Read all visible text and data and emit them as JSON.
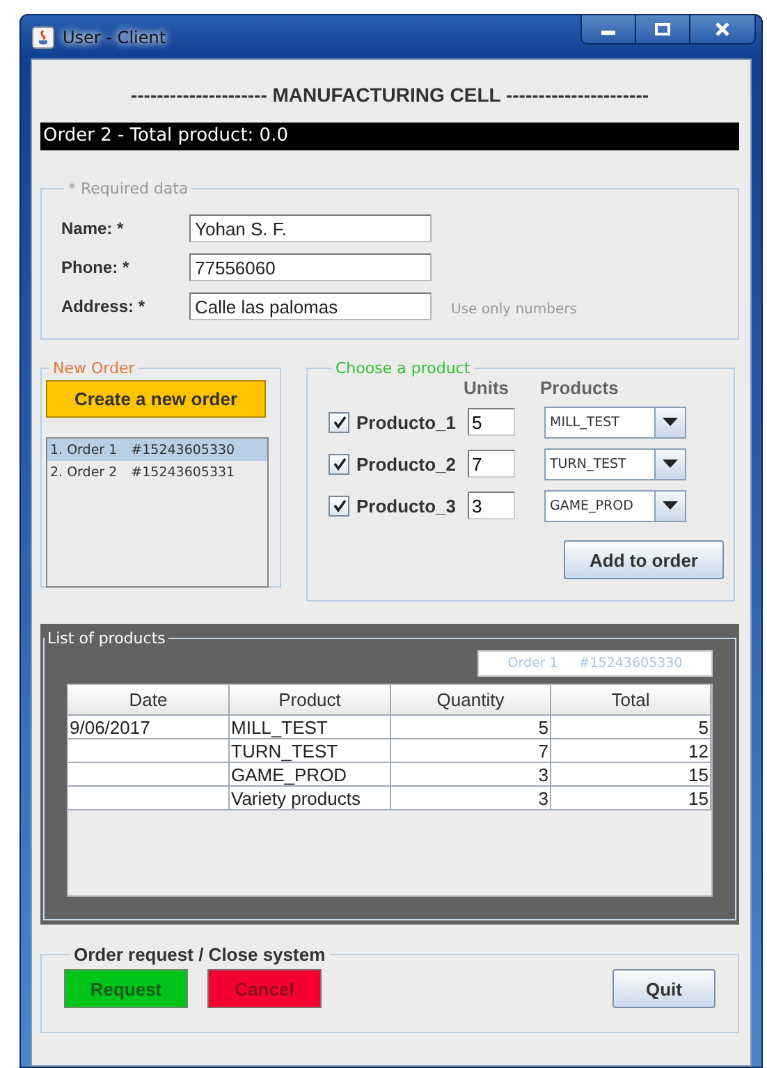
{
  "window": {
    "title": "User - Client"
  },
  "heading": "--------------------- MANUFACTURING CELL ----------------------",
  "status_bar": "Order 2 - Total product: 0.0",
  "required_data": {
    "legend": "* Required data",
    "fields": [
      {
        "label": "Name: *",
        "value": "Yohan S. F."
      },
      {
        "label": "Phone: *",
        "value": "77556060"
      },
      {
        "label": "Address: *",
        "value": "Calle las palomas",
        "hint": "Use only numbers"
      }
    ]
  },
  "new_order": {
    "legend": "New Order",
    "button": "Create a new order",
    "orders": [
      {
        "label": "1. Order 1",
        "id": "#15243605330",
        "selected": true
      },
      {
        "label": "2. Order 2",
        "id": "#15243605331",
        "selected": false
      }
    ]
  },
  "choose_product": {
    "legend": "Choose a product",
    "units_header": "Units",
    "products_header": "Products",
    "items": [
      {
        "name": "Producto_1",
        "checked": true,
        "units": "5",
        "product": "MILL_TEST"
      },
      {
        "name": "Producto_2",
        "checked": true,
        "units": "7",
        "product": "TURN_TEST"
      },
      {
        "name": "Producto_3",
        "checked": true,
        "units": "3",
        "product": "GAME_PROD"
      }
    ],
    "button": "Add to order"
  },
  "product_list": {
    "legend": "List of products",
    "order_label": "Order 1",
    "order_id": "#15243605330",
    "columns": [
      "Date",
      "Product",
      "Quantity",
      "Total"
    ],
    "rows": [
      {
        "date": "9/06/2017",
        "product": "MILL_TEST",
        "quantity": "5",
        "total": "5"
      },
      {
        "product": "TURN_TEST",
        "quantity": "7",
        "total": "12"
      },
      {
        "product": "GAME_PROD",
        "quantity": "3",
        "total": "15"
      },
      {
        "product": "Variety products",
        "quantity": "3",
        "total": "15"
      }
    ]
  },
  "order_request": {
    "legend": "Order request / Close system",
    "buttons": [
      {
        "label": "Request",
        "kind": "request"
      },
      {
        "label": "Cancel",
        "kind": "cancel"
      },
      {
        "label": "Quit",
        "kind": "quit"
      }
    ]
  }
}
